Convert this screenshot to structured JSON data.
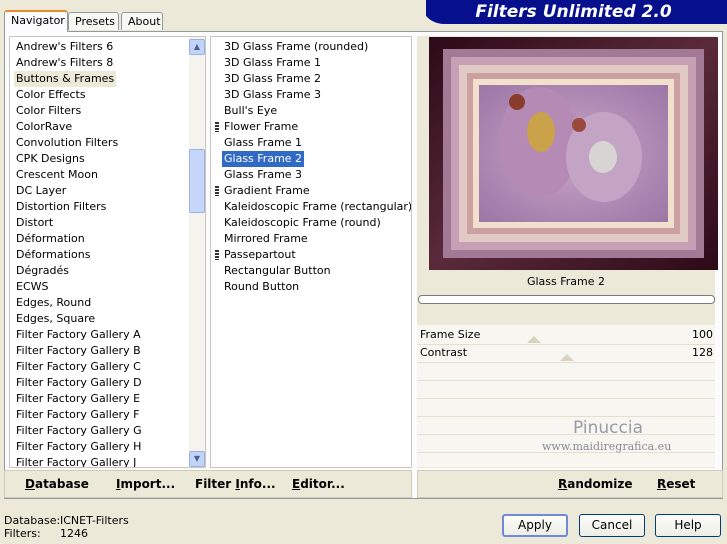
{
  "banner": {
    "title": "Filters Unlimited 2.0"
  },
  "tabs": [
    {
      "label": "Navigator"
    },
    {
      "label": "Presets"
    },
    {
      "label": "About"
    }
  ],
  "categories": [
    "Andrew's Filters 6",
    "Andrew's Filters 8",
    "Buttons & Frames",
    "Color Effects",
    "Color Filters",
    "ColorRave",
    "Convolution Filters",
    "CPK Designs",
    "Crescent Moon",
    "DC Layer",
    "Distortion Filters",
    "Distort",
    "Déformation",
    "Déformations",
    "Dégradés",
    "ECWS",
    "Edges, Round",
    "Edges, Square",
    "Filter Factory Gallery A",
    "Filter Factory Gallery B",
    "Filter Factory Gallery C",
    "Filter Factory Gallery D",
    "Filter Factory Gallery E",
    "Filter Factory Gallery F",
    "Filter Factory Gallery G",
    "Filter Factory Gallery H",
    "Filter Factory Gallery J"
  ],
  "selected_category_index": 2,
  "filters": [
    {
      "label": "3D Glass Frame (rounded)",
      "marker": false
    },
    {
      "label": "3D Glass Frame 1",
      "marker": false
    },
    {
      "label": "3D Glass Frame 2",
      "marker": false
    },
    {
      "label": "3D Glass Frame 3",
      "marker": false
    },
    {
      "label": "Bull's Eye",
      "marker": false
    },
    {
      "label": "Flower Frame",
      "marker": true
    },
    {
      "label": "Glass Frame 1",
      "marker": false
    },
    {
      "label": "Glass Frame 2",
      "marker": false
    },
    {
      "label": "Glass Frame 3",
      "marker": false
    },
    {
      "label": "Gradient Frame",
      "marker": true
    },
    {
      "label": "Kaleidoscopic Frame (rectangular)",
      "marker": false
    },
    {
      "label": "Kaleidoscopic Frame (round)",
      "marker": false
    },
    {
      "label": "Mirrored Frame",
      "marker": false
    },
    {
      "label": "Passepartout",
      "marker": true
    },
    {
      "label": "Rectangular Button",
      "marker": false
    },
    {
      "label": "Round Button",
      "marker": false
    }
  ],
  "selected_filter_index": 7,
  "left_bar": {
    "database": {
      "pre": "",
      "ul": "D",
      "post": "atabase"
    },
    "import": {
      "pre": "",
      "ul": "I",
      "post": "mport..."
    },
    "filter_info": {
      "pre": "Filter ",
      "ul": "I",
      "post": "nfo..."
    },
    "editor": {
      "pre": "",
      "ul": "E",
      "post": "ditor..."
    }
  },
  "preview": {
    "filter_name": "Glass Frame 2",
    "watermark_name": "Pinuccia",
    "watermark_url": "www.maidiregrafica.eu",
    "progress": 0
  },
  "params": [
    {
      "label": "Frame Size",
      "value": "100"
    },
    {
      "label": "Contrast",
      "value": "128"
    }
  ],
  "right_bar": {
    "randomize": {
      "pre": "",
      "ul": "R",
      "post": "andomize"
    },
    "reset": {
      "pre": "",
      "ul": "R",
      "post": "eset"
    }
  },
  "status": {
    "database_label": "Database:",
    "database_value": "ICNET-Filters",
    "filters_label": "Filters:",
    "filters_value": "1246"
  },
  "buttons": {
    "apply": "Apply",
    "cancel": "Cancel",
    "help": "Help"
  },
  "icons": {
    "scroll_up": "chevron-up-icon",
    "scroll_down": "chevron-down-icon"
  },
  "colors": {
    "banner": "#06108c",
    "selection_blue": "#316ac5",
    "selection_gray": "#ece9d8",
    "tab_accent": "#e68b2c"
  }
}
